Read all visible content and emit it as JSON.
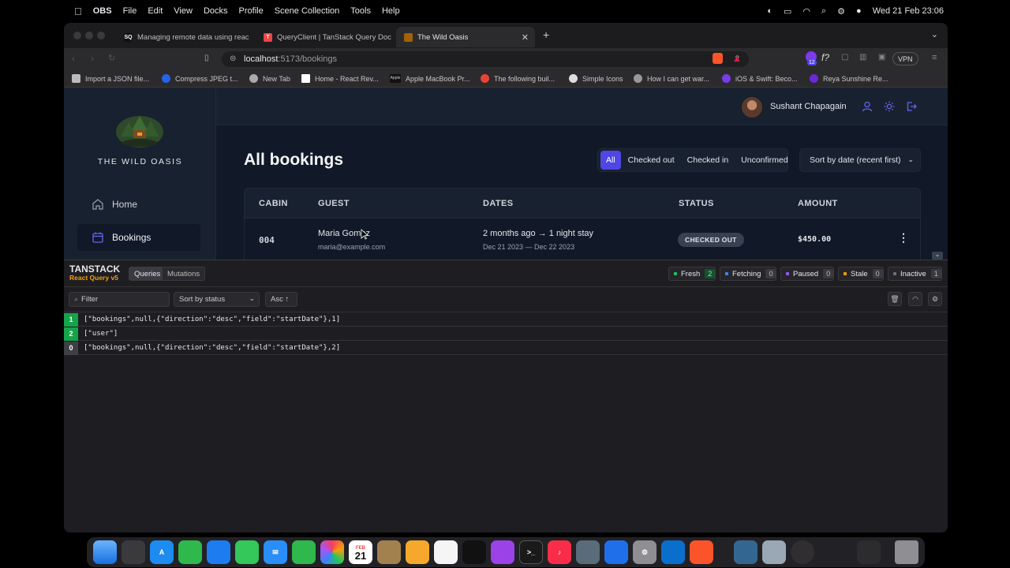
{
  "menubar": {
    "app": "OBS",
    "menus": [
      "File",
      "Edit",
      "View",
      "Docks",
      "Profile",
      "Scene Collection",
      "Tools",
      "Help"
    ],
    "clock": "Wed 21 Feb  23:06"
  },
  "browser": {
    "tabs": [
      {
        "favicon": "SQ",
        "title": "Managing remote data using reac"
      },
      {
        "favicon": "T",
        "title": "QueryClient | TanStack Query Doc"
      },
      {
        "favicon": "",
        "title": "The Wild Oasis"
      }
    ],
    "url_host": "localhost",
    "url_path": ":5173/bookings",
    "vpn_label": "VPN",
    "ext_badge": "12",
    "bookmarks": [
      "Import a JSON file...",
      "Compress JPEG t...",
      "New Tab",
      "Home - React Rev...",
      "Apple MacBook Pr...",
      "The following buil...",
      "Simple Icons",
      "How I can get war...",
      "iOS & Swift: Beco...",
      "Reya Sunshine Re..."
    ],
    "bookmark_logos": {
      "apple": "Apple"
    }
  },
  "app": {
    "brand": "THE WILD OASIS",
    "nav": [
      {
        "label": "Home"
      },
      {
        "label": "Bookings"
      }
    ],
    "user_name": "Sushant Chapagain",
    "page_title": "All bookings",
    "filters": [
      "All",
      "Checked out",
      "Checked in",
      "Unconfirmed"
    ],
    "sort_label": "Sort by date (recent first)",
    "columns": [
      "CABIN",
      "GUEST",
      "DATES",
      "STATUS",
      "AMOUNT"
    ],
    "rows": [
      {
        "cabin": "004",
        "guest_name": "Maria Gomez",
        "guest_email": "maria@example.com",
        "dates": "2 months ago → 1 night stay",
        "date_range": "Dec 21 2023 — Dec 22 2023",
        "status": "CHECKED OUT",
        "amount": "$450.00"
      }
    ]
  },
  "devtools": {
    "brand": "TANSTACK",
    "subbrand": "React Query v5",
    "tabs": [
      "Queries",
      "Mutations"
    ],
    "counters": [
      {
        "label": "Fresh",
        "count": "2",
        "color": "#22c55e"
      },
      {
        "label": "Fetching",
        "count": "0",
        "color": "#3b82f6"
      },
      {
        "label": "Paused",
        "count": "0",
        "color": "#8b5cf6"
      },
      {
        "label": "Stale",
        "count": "0",
        "color": "#f59e0b"
      },
      {
        "label": "Inactive",
        "count": "1",
        "color": "#6b7280"
      }
    ],
    "filter_placeholder": "Filter",
    "sort_label": "Sort by status",
    "order_label": "Asc ↑",
    "queries": [
      {
        "count": "1",
        "key": "[\"bookings\",null,{\"direction\":\"desc\",\"field\":\"startDate\"},1]",
        "color": "#16a34a"
      },
      {
        "count": "2",
        "key": "[\"user\"]",
        "color": "#16a34a"
      },
      {
        "count": "0",
        "key": "[\"bookings\",null,{\"direction\":\"desc\",\"field\":\"startDate\"},2]",
        "color": "#3f3f46"
      }
    ]
  },
  "dock": {
    "calendar_month": "FEB",
    "calendar_day": "21"
  }
}
